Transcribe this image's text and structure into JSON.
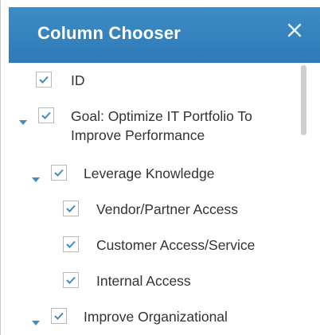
{
  "dialog": {
    "title": "Column Chooser",
    "close_glyph": "×"
  },
  "tree": {
    "items": [
      {
        "label": "ID",
        "checked": true,
        "expandable": false
      },
      {
        "label": "Goal: Optimize IT Portfolio To Improve Performance",
        "checked": true,
        "expandable": true,
        "expanded": true
      },
      {
        "label": "Leverage Knowledge",
        "checked": true,
        "expandable": true,
        "expanded": true
      },
      {
        "label": "Vendor/Partner Access",
        "checked": true,
        "expandable": false
      },
      {
        "label": "Customer Access/Service",
        "checked": true,
        "expandable": false
      },
      {
        "label": "Internal Access",
        "checked": true,
        "expandable": false
      },
      {
        "label": "Improve Organizational",
        "checked": true,
        "expandable": true,
        "expanded": true
      }
    ]
  },
  "colors": {
    "header": "#2f7ab7",
    "accent": "#3d8cc6",
    "checkmark": "#3d8cc6"
  },
  "icons": {
    "close": "close-icon",
    "expand": "caret-down-icon",
    "check": "checkmark-icon"
  }
}
